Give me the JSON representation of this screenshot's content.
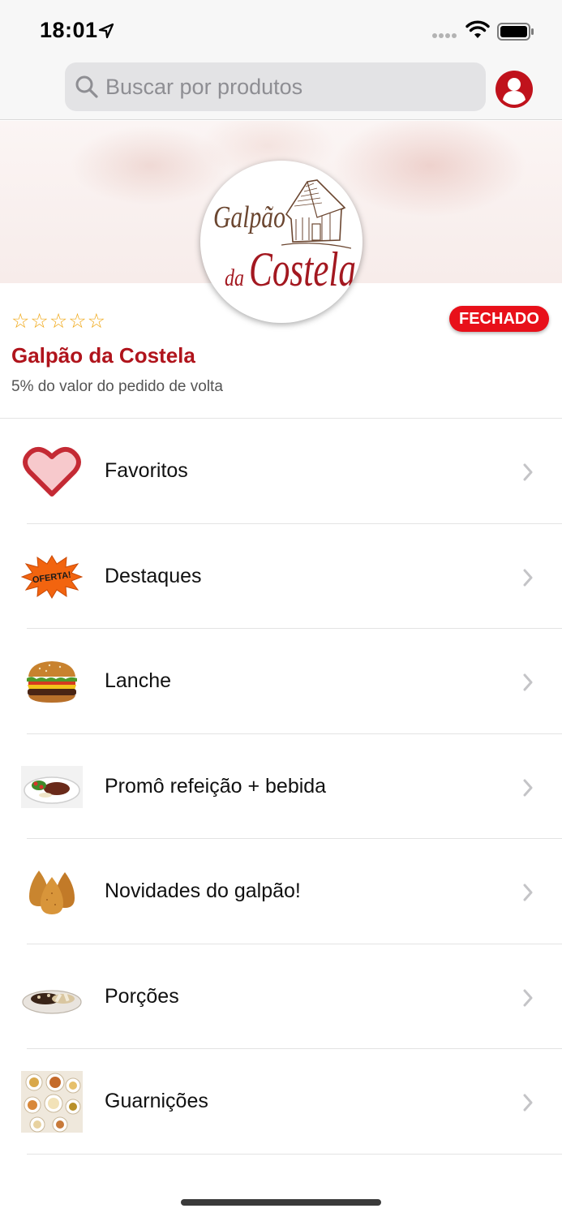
{
  "status_bar": {
    "time": "18:01"
  },
  "search": {
    "placeholder": "Buscar por produtos"
  },
  "store": {
    "logo_text_top": "Galpão",
    "logo_text_da": "da",
    "logo_text_bottom": "Costela",
    "rating_stars": "☆☆☆☆☆",
    "status_badge": "FECHADO",
    "name": "Galpão da Costela",
    "cashback": "5% do valor do pedido de volta"
  },
  "categories": [
    {
      "label": "Favoritos",
      "icon": "heart-icon"
    },
    {
      "label": "Destaques",
      "icon": "oferta-badge-icon",
      "icon_text": "OFERTA!"
    },
    {
      "label": "Lanche",
      "icon": "burger-icon"
    },
    {
      "label": "Promô refeição + bebida",
      "icon": "meal-plate-icon"
    },
    {
      "label": "Novidades do galpão!",
      "icon": "coxinha-icon"
    },
    {
      "label": "Porções",
      "icon": "portion-plate-icon"
    },
    {
      "label": "Guarnições",
      "icon": "side-dishes-icon"
    }
  ],
  "colors": {
    "brand_red": "#b0141c",
    "badge_red": "#e8101a",
    "star_orange": "#f0a818"
  }
}
